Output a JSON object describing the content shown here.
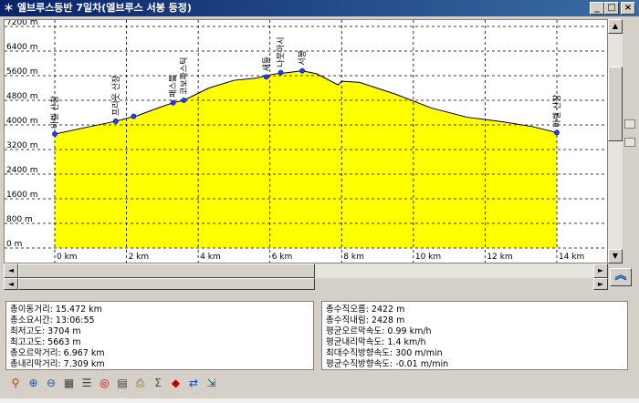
{
  "window": {
    "title": "＊ 엘브루스등반 7일차(엘브루스 서봉 등정)",
    "minimize_label": "_",
    "maximize_label": "□",
    "close_label": "×"
  },
  "chart_data": {
    "type": "area",
    "xlabel": "",
    "ylabel": "",
    "xlim": [
      0,
      14
    ],
    "ylim": [
      0,
      7200
    ],
    "grid": true,
    "fill_color": "#ffff00",
    "x_ticks": [
      {
        "value": 0,
        "label": "0 km"
      },
      {
        "value": 2,
        "label": "2 km"
      },
      {
        "value": 4,
        "label": "4 km"
      },
      {
        "value": 6,
        "label": "6 km"
      },
      {
        "value": 8,
        "label": "8 km"
      },
      {
        "value": 10,
        "label": "10 km"
      },
      {
        "value": 12,
        "label": "12 km"
      },
      {
        "value": 14,
        "label": "14 km"
      }
    ],
    "y_ticks": [
      {
        "value": 0,
        "label": "0 m"
      },
      {
        "value": 800,
        "label": "800 m"
      },
      {
        "value": 1600,
        "label": "1600 m"
      },
      {
        "value": 2400,
        "label": "2400 m"
      },
      {
        "value": 3200,
        "label": "3200 m"
      },
      {
        "value": 4000,
        "label": "4000 m"
      },
      {
        "value": 4800,
        "label": "4800 m"
      },
      {
        "value": 5600,
        "label": "5600 m"
      },
      {
        "value": 6400,
        "label": "6400 m"
      },
      {
        "value": 7200,
        "label": "7200 m"
      }
    ],
    "x": [
      0,
      1.0,
      1.7,
      2.3,
      3.0,
      3.3,
      3.6,
      4.3,
      5.0,
      5.6,
      6.1,
      6.5,
      6.9,
      7.3,
      7.9,
      8.0,
      8.5,
      9.5,
      10.5,
      11.5,
      12.5,
      13.3,
      14.0
    ],
    "y": [
      3704,
      3950,
      4120,
      4300,
      4600,
      4720,
      4800,
      5200,
      5450,
      5520,
      5650,
      5700,
      5760,
      5663,
      5300,
      5420,
      5380,
      5000,
      4550,
      4250,
      4100,
      3950,
      3750
    ],
    "waypoints": [
      {
        "x": 0.0,
        "y": 3704,
        "label": "바렐 산장"
      },
      {
        "x": 1.7,
        "y": 4120,
        "label": "프리웃 산장"
      },
      {
        "x": 2.2,
        "y": 4280,
        "label": ""
      },
      {
        "x": 3.3,
        "y": 4720,
        "label": "패스틀"
      },
      {
        "x": 3.6,
        "y": 4800,
        "label": "코보파스틱"
      },
      {
        "x": 5.9,
        "y": 5560,
        "label": "새들"
      },
      {
        "x": 6.3,
        "y": 5700,
        "label": "나뭇마시"
      },
      {
        "x": 6.9,
        "y": 5760,
        "label": "서봉"
      },
      {
        "x": 14.0,
        "y": 3750,
        "label": "바렐 산장"
      }
    ]
  },
  "stats_left": [
    "총이동거리: 15.472 km",
    "총소요시간: 13:06:55",
    "최저고도: 3704 m",
    "최고고도: 5663 m",
    "총오르막거리: 6.967 km",
    "총내리막거리: 7.309 km"
  ],
  "stats_right": [
    "총수직오름: 2422 m",
    "총수직내림: 2428 m",
    "평균오르막속도: 0.99 km/h",
    "평균내리막속도: 1.4 km/h",
    "최대수직방향속도: 300 m/min",
    "평균수직방향속도: -0.01 m/min"
  ],
  "toolbar": [
    {
      "name": "map-pin-icon",
      "glyph": "⚲",
      "color": "#c04000"
    },
    {
      "name": "zoom-in-icon",
      "glyph": "⊕",
      "color": "#2050a0"
    },
    {
      "name": "zoom-out-icon",
      "glyph": "⊖",
      "color": "#2050a0"
    },
    {
      "name": "grid-icon",
      "glyph": "▦",
      "color": "#404040"
    },
    {
      "name": "list-icon",
      "glyph": "☰",
      "color": "#404040"
    },
    {
      "name": "search-icon",
      "glyph": "◎",
      "color": "#c00000"
    },
    {
      "name": "document-icon",
      "glyph": "▤",
      "color": "#404040"
    },
    {
      "name": "print-icon",
      "glyph": "⎙",
      "color": "#806000"
    },
    {
      "name": "sum-icon",
      "glyph": "Σ",
      "color": "#008000"
    },
    {
      "name": "record-icon",
      "glyph": "◆",
      "color": "#c00000"
    },
    {
      "name": "swap-icon",
      "glyph": "⇄",
      "color": "#1040c0"
    },
    {
      "name": "exit-icon",
      "glyph": "⇲",
      "color": "#006080"
    }
  ],
  "scroll": {
    "up": "▲",
    "down": "▼",
    "left": "◄",
    "right": "►",
    "collapse": "︽"
  }
}
